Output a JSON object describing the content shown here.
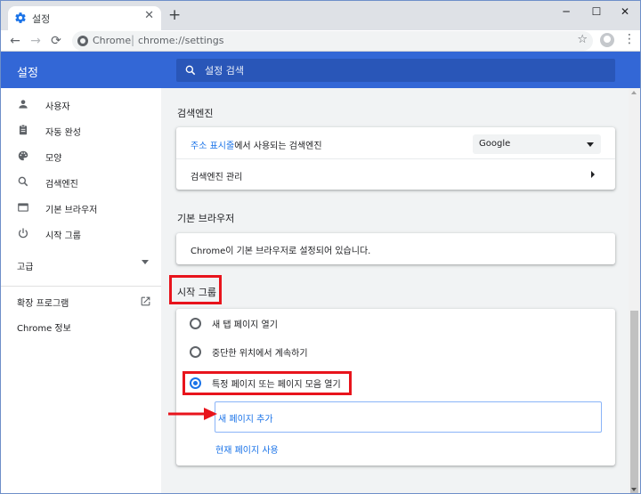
{
  "browser": {
    "tab_title": "설정",
    "tab_close": "✕",
    "new_tab": "+",
    "window_buttons": {
      "minimize": "─",
      "maximize": "☐",
      "close": "✕"
    },
    "address": {
      "origin": "Chrome",
      "separator": "|",
      "url": "chrome://settings"
    },
    "nav": {
      "back": "←",
      "forward": "→",
      "reload": "⟳",
      "star": "☆",
      "menu": "⋮"
    }
  },
  "header": {
    "title": "설정",
    "search_placeholder": "설정 검색"
  },
  "sidebar": {
    "items": [
      {
        "label": "사용자",
        "icon": "person-icon"
      },
      {
        "label": "자동 완성",
        "icon": "clipboard-icon"
      },
      {
        "label": "모양",
        "icon": "palette-icon"
      },
      {
        "label": "검색엔진",
        "icon": "search-icon"
      },
      {
        "label": "기본 브라우저",
        "icon": "browser-icon"
      },
      {
        "label": "시작 그룹",
        "icon": "power-icon"
      }
    ],
    "advanced": "고급",
    "extensions": "확장 프로그램",
    "about": "Chrome 정보"
  },
  "sections": {
    "search_engine": {
      "title": "검색엔진",
      "row1_link": "주소 표시줄",
      "row1_text": "에서 사용되는 검색엔진",
      "select_value": "Google",
      "row2": "검색엔진 관리"
    },
    "default_browser": {
      "title": "기본 브라우저",
      "text": "Chrome이 기본 브라우저로 설정되어 있습니다."
    },
    "startup": {
      "title": "시작 그룹",
      "options": [
        {
          "label": "새 탭 페이지 열기",
          "checked": false
        },
        {
          "label": "중단한 위치에서 계속하기",
          "checked": false
        },
        {
          "label": "특정 페이지 또는 페이지 모음 열기",
          "checked": true
        }
      ],
      "add_page": "새 페이지 추가",
      "use_current": "현재 페이지 사용"
    }
  },
  "colors": {
    "header": "#3367d6",
    "accent": "#1a73e8",
    "highlight": "#e8141c"
  }
}
